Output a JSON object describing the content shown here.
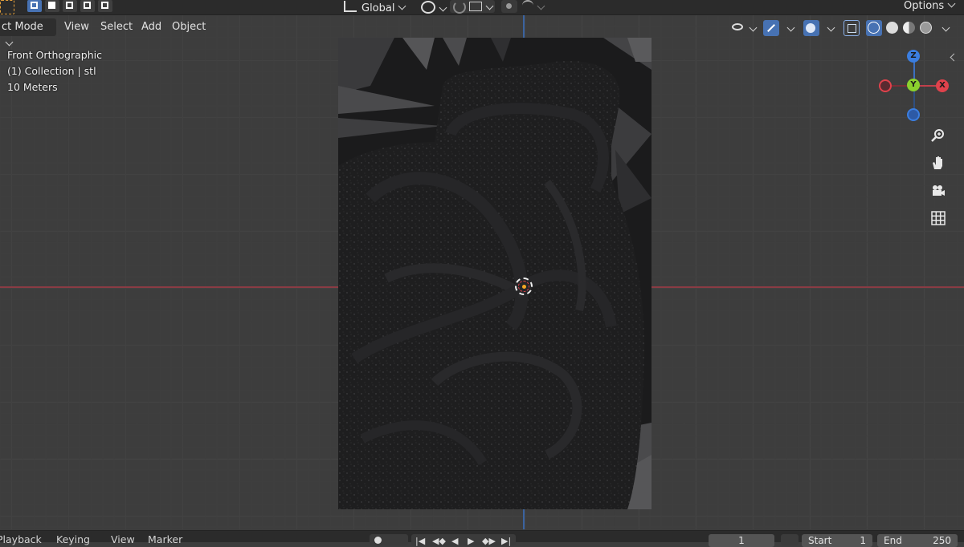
{
  "top_header": {
    "orientation_label": "Global",
    "options_label": "Options"
  },
  "view_header": {
    "mode_label": "ct Mode",
    "menus": [
      "View",
      "Select",
      "Add",
      "Object"
    ]
  },
  "overlay": {
    "view_name": "Front Orthographic",
    "collection": "(1) Collection | stl",
    "scale": "10 Meters"
  },
  "gizmo": {
    "x_label": "X",
    "y_label": "Y",
    "z_label": "Z",
    "x_color": "#e0424c",
    "y_color": "#8bd12e",
    "z_color": "#3b7ee0"
  },
  "nav_icons": [
    "zoom-icon",
    "hand-pan-icon",
    "camera-icon",
    "grid-icon"
  ],
  "timeline": {
    "playback_label": "Playback",
    "keying_label": "Keying",
    "view_label": "View",
    "marker_label": "Marker",
    "current_frame": "1",
    "start_label": "Start",
    "start_value": "1",
    "end_label": "End",
    "end_value": "250"
  }
}
